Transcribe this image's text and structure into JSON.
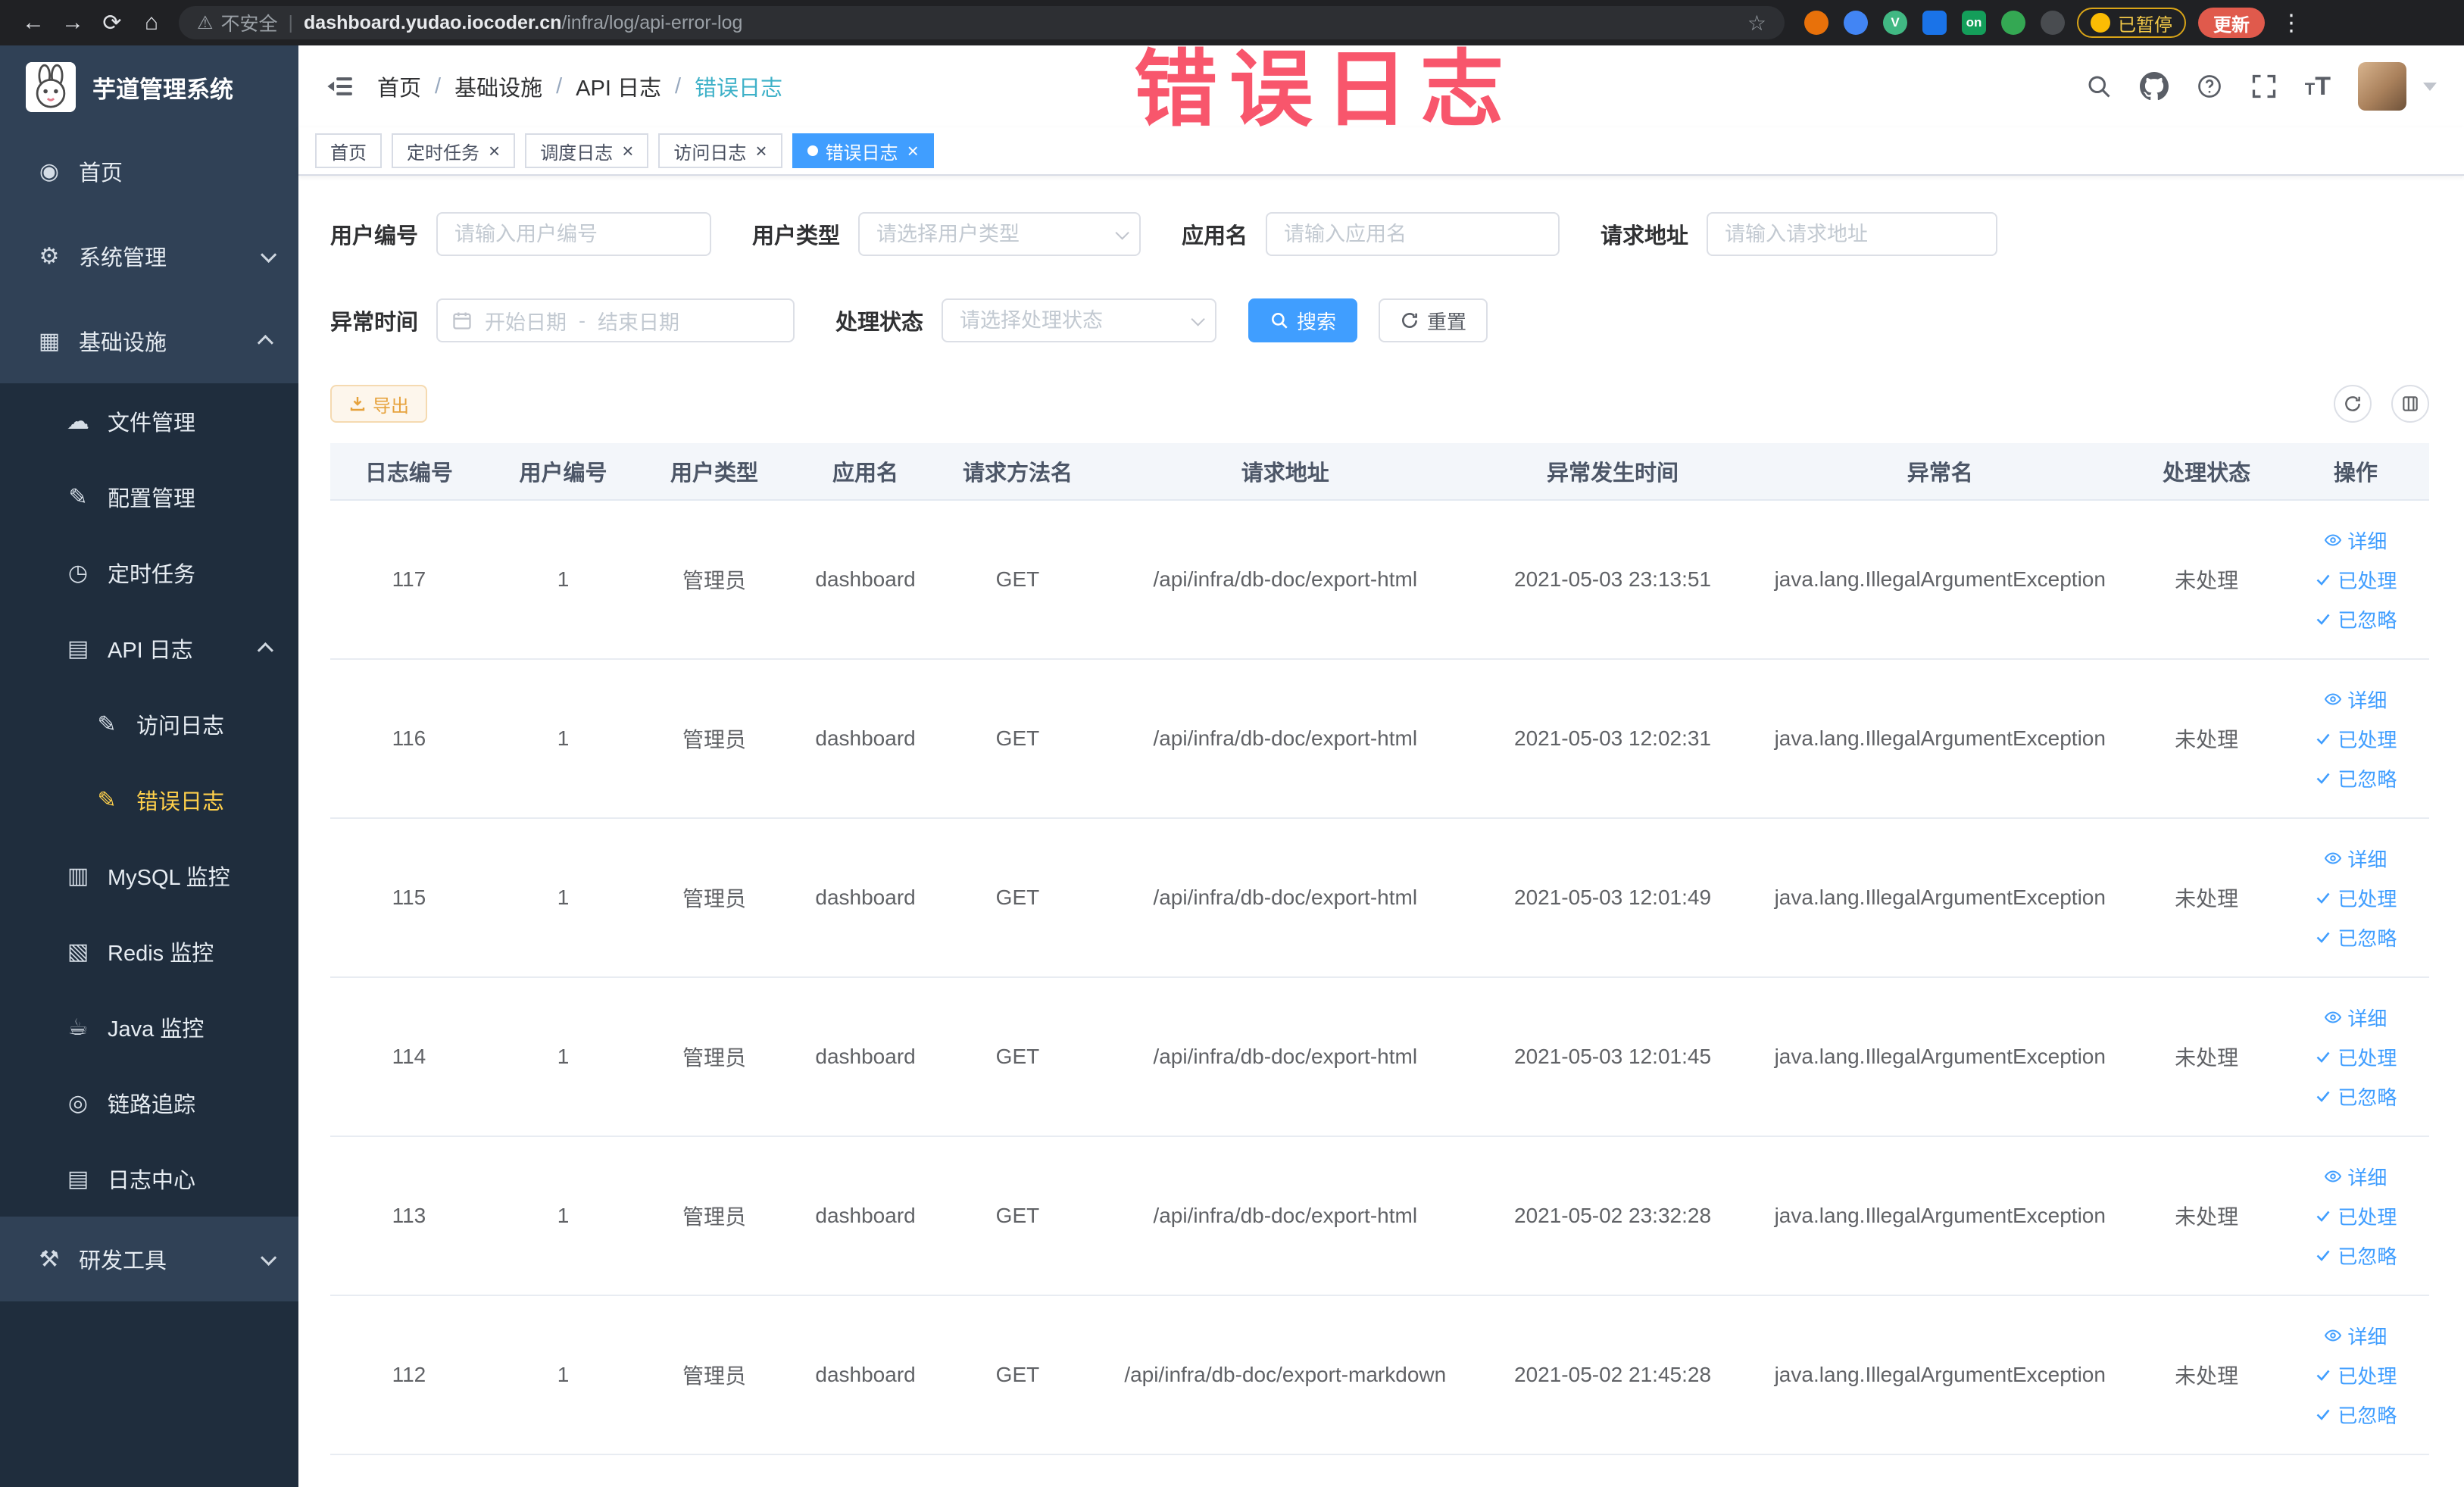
{
  "colors": {
    "accent": "#409eff",
    "sidebar_bg": "#304156",
    "submenu_bg": "#1f2d3d",
    "sidebar_active": "#ffd04b",
    "annotation": "#f8566c",
    "warning": "#e6a23c",
    "tab_active": "#409eff"
  },
  "annotation": {
    "text": "错误日志"
  },
  "browser": {
    "security_label": "不安全",
    "url_host": "dashboard.yudao.iocoder.cn",
    "url_path": "/infra/log/api-error-log",
    "paused_badge": "已暂停",
    "update_button": "更新",
    "extensions": [
      {
        "name": "extension-orange-icon",
        "color": "#e8710a",
        "label": "",
        "shape": "circle"
      },
      {
        "name": "extension-blue-icon",
        "color": "#4285f4",
        "label": "",
        "shape": "circle"
      },
      {
        "name": "vue-devtools-icon",
        "color": "#41b883",
        "label": "V",
        "shape": "circle"
      },
      {
        "name": "extension-grid-icon",
        "color": "#1a73e8",
        "label": "",
        "shape": "square"
      },
      {
        "name": "switchyomega-on-icon",
        "color": "#149e5a",
        "label": "on",
        "shape": "square"
      },
      {
        "name": "extension-leaf-icon",
        "color": "#34a853",
        "label": "",
        "shape": "circle"
      },
      {
        "name": "extension-paw-icon",
        "color": "#494c50",
        "label": "",
        "shape": "circle"
      }
    ]
  },
  "sidebar": {
    "logo_title": "芋道管理系统",
    "items": [
      {
        "key": "home",
        "label": "首页",
        "icon": "◉",
        "icon_name": "home-icon",
        "level": 1,
        "sub": false
      },
      {
        "key": "system",
        "label": "系统管理",
        "icon": "⚙",
        "icon_name": "gear-icon",
        "level": 1,
        "sub": false,
        "arrow": "down"
      },
      {
        "key": "infra",
        "label": "基础设施",
        "icon": "▦",
        "icon_name": "infrastructure-icon",
        "level": 1,
        "sub": false,
        "arrow": "up"
      },
      {
        "key": "file",
        "label": "文件管理",
        "icon": "☁",
        "icon_name": "file-manage-icon",
        "level": 2,
        "sub": true
      },
      {
        "key": "config",
        "label": "配置管理",
        "icon": "✎",
        "icon_name": "config-icon",
        "level": 2,
        "sub": true
      },
      {
        "key": "job",
        "label": "定时任务",
        "icon": "◷",
        "icon_name": "timer-icon",
        "level": 2,
        "sub": true
      },
      {
        "key": "api-log",
        "label": "API 日志",
        "icon": "▤",
        "icon_name": "api-log-icon",
        "level": 2,
        "sub": true,
        "arrow": "up"
      },
      {
        "key": "access-log",
        "label": "访问日志",
        "icon": "✎",
        "icon_name": "access-log-icon",
        "level": 3,
        "sub": true
      },
      {
        "key": "error-log",
        "label": "错误日志",
        "icon": "✎",
        "icon_name": "error-log-icon",
        "level": 3,
        "sub": true,
        "active": true
      },
      {
        "key": "mysql",
        "label": "MySQL 监控",
        "icon": "▥",
        "icon_name": "mysql-monitor-icon",
        "level": 2,
        "sub": true
      },
      {
        "key": "redis",
        "label": "Redis 监控",
        "icon": "▧",
        "icon_name": "redis-monitor-icon",
        "level": 2,
        "sub": true
      },
      {
        "key": "java",
        "label": "Java 监控",
        "icon": "☕",
        "icon_name": "java-monitor-icon",
        "level": 2,
        "sub": true
      },
      {
        "key": "trace",
        "label": "链路追踪",
        "icon": "◎",
        "icon_name": "trace-icon",
        "level": 2,
        "sub": true
      },
      {
        "key": "log-center",
        "label": "日志中心",
        "icon": "▤",
        "icon_name": "log-center-icon",
        "level": 2,
        "sub": true
      },
      {
        "key": "tools",
        "label": "研发工具",
        "icon": "⚒",
        "icon_name": "dev-tools-icon",
        "level": 1,
        "sub": false,
        "arrow": "down"
      }
    ]
  },
  "header": {
    "breadcrumb": [
      "首页",
      "基础设施",
      "API 日志",
      "错误日志"
    ]
  },
  "tabs": [
    {
      "key": "home",
      "label": "首页",
      "closable": false,
      "active": false
    },
    {
      "key": "job",
      "label": "定时任务",
      "closable": true,
      "active": false
    },
    {
      "key": "job-log",
      "label": "调度日志",
      "closable": true,
      "active": false
    },
    {
      "key": "access-log",
      "label": "访问日志",
      "closable": true,
      "active": false
    },
    {
      "key": "error-log",
      "label": "错误日志",
      "closable": true,
      "active": true
    }
  ],
  "filters": {
    "user_id": {
      "label": "用户编号",
      "placeholder": "请输入用户编号"
    },
    "user_type": {
      "label": "用户类型",
      "placeholder": "请选择用户类型"
    },
    "app_name": {
      "label": "应用名",
      "placeholder": "请输入应用名"
    },
    "request_url": {
      "label": "请求地址",
      "placeholder": "请输入请求地址"
    },
    "exception_time": {
      "label": "异常时间",
      "start_placeholder": "开始日期",
      "separator": "-",
      "end_placeholder": "结束日期"
    },
    "process_status": {
      "label": "处理状态",
      "placeholder": "请选择处理状态"
    },
    "search_button": "搜索",
    "reset_button": "重置"
  },
  "toolbar": {
    "export_label": "导出"
  },
  "table": {
    "columns": [
      "日志编号",
      "用户编号",
      "用户类型",
      "应用名",
      "请求方法名",
      "请求地址",
      "异常发生时间",
      "异常名",
      "处理状态",
      "操作"
    ],
    "field_order": [
      "id",
      "user_id",
      "user_type",
      "app",
      "method",
      "url",
      "time",
      "exception",
      "status"
    ],
    "actions": [
      "详细",
      "已处理",
      "已忽略"
    ],
    "rows": [
      {
        "id": "117",
        "user_id": "1",
        "user_type": "管理员",
        "app": "dashboard",
        "method": "GET",
        "url": "/api/infra/db-doc/export-html",
        "time": "2021-05-03 23:13:51",
        "exception": "java.lang.IllegalArgumentException",
        "status": "未处理"
      },
      {
        "id": "116",
        "user_id": "1",
        "user_type": "管理员",
        "app": "dashboard",
        "method": "GET",
        "url": "/api/infra/db-doc/export-html",
        "time": "2021-05-03 12:02:31",
        "exception": "java.lang.IllegalArgumentException",
        "status": "未处理"
      },
      {
        "id": "115",
        "user_id": "1",
        "user_type": "管理员",
        "app": "dashboard",
        "method": "GET",
        "url": "/api/infra/db-doc/export-html",
        "time": "2021-05-03 12:01:49",
        "exception": "java.lang.IllegalArgumentException",
        "status": "未处理"
      },
      {
        "id": "114",
        "user_id": "1",
        "user_type": "管理员",
        "app": "dashboard",
        "method": "GET",
        "url": "/api/infra/db-doc/export-html",
        "time": "2021-05-03 12:01:45",
        "exception": "java.lang.IllegalArgumentException",
        "status": "未处理"
      },
      {
        "id": "113",
        "user_id": "1",
        "user_type": "管理员",
        "app": "dashboard",
        "method": "GET",
        "url": "/api/infra/db-doc/export-html",
        "time": "2021-05-02 23:32:28",
        "exception": "java.lang.IllegalArgumentException",
        "status": "未处理"
      },
      {
        "id": "112",
        "user_id": "1",
        "user_type": "管理员",
        "app": "dashboard",
        "method": "GET",
        "url": "/api/infra/db-doc/export-markdown",
        "time": "2021-05-02 21:45:28",
        "exception": "java.lang.IllegalArgumentException",
        "status": "未处理"
      }
    ]
  }
}
